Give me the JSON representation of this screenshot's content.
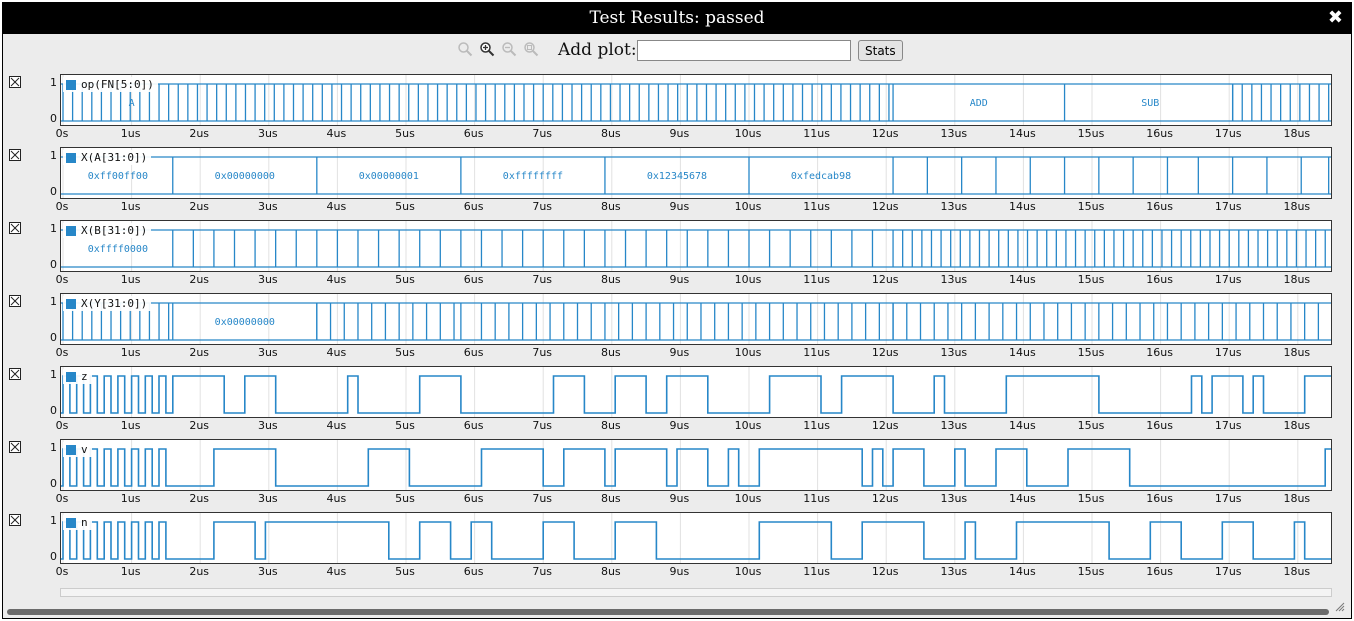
{
  "window": {
    "title": "Test Results: passed"
  },
  "toolbar": {
    "zoom_icons": [
      "zoom-out-disabled-icon",
      "zoom-in-icon",
      "zoom-reset-icon",
      "zoom-fit-icon"
    ],
    "add_plot_label": "Add plot:",
    "add_plot_value": "",
    "stats_label": "Stats"
  },
  "axis": {
    "x_ticks": [
      "0s",
      "1us",
      "2us",
      "3us",
      "4us",
      "5us",
      "6us",
      "7us",
      "8us",
      "9us",
      "10us",
      "11us",
      "12us",
      "13us",
      "14us",
      "15us",
      "16us",
      "17us",
      "18us"
    ],
    "y_ticks": [
      "1",
      "0"
    ],
    "x_range_us": [
      0,
      18.6
    ]
  },
  "colors": {
    "trace": "#2787c8",
    "text_on_trace": "#2787c8"
  },
  "plots": [
    {
      "name": "op(FN[5:0])",
      "kind": "bus",
      "fill": [
        [
          0,
          12.1,
          0.14
        ],
        [
          17.05,
          18.6,
          0.14
        ]
      ],
      "trans": [
        12.1,
        14.6,
        17.05
      ],
      "text": [
        {
          "t": 1.0,
          "v": "A"
        },
        {
          "t": 13.35,
          "v": "ADD"
        },
        {
          "t": 15.85,
          "v": "SUB"
        }
      ]
    },
    {
      "name": "X(A[31:0])",
      "kind": "bus",
      "fill": [],
      "trans": [
        1.6,
        3.7,
        5.8,
        7.9,
        10.0,
        12.1,
        12.6,
        13.1,
        13.6,
        14.1,
        14.6,
        15.1,
        15.6,
        16.1,
        16.55,
        17.05,
        17.55,
        18.05,
        18.45
      ],
      "text": [
        {
          "t": 0.8,
          "v": "0xff00ff00"
        },
        {
          "t": 2.65,
          "v": "0x00000000"
        },
        {
          "t": 4.75,
          "v": "0x00000001"
        },
        {
          "t": 6.85,
          "v": "0xffffffff"
        },
        {
          "t": 8.95,
          "v": "0x12345678"
        },
        {
          "t": 11.05,
          "v": "0xfedcab98"
        }
      ]
    },
    {
      "name": "X(B[31:0])",
      "kind": "bus",
      "fill": [
        [
          12.1,
          18.6,
          0.14
        ]
      ],
      "trans": [
        1.6,
        1.9,
        2.2,
        2.5,
        2.8,
        3.1,
        3.4,
        3.7,
        4.0,
        4.3,
        4.6,
        4.9,
        5.2,
        5.5,
        5.8,
        6.1,
        6.4,
        6.7,
        7.0,
        7.3,
        7.6,
        7.9,
        8.2,
        8.5,
        8.8,
        9.1,
        9.4,
        9.7,
        10.0,
        10.3,
        10.6,
        10.9,
        11.2,
        11.5,
        11.8
      ],
      "text": [
        {
          "t": 0.8,
          "v": "0xffff0000"
        }
      ]
    },
    {
      "name": "X(Y[31:0])",
      "kind": "bus",
      "fill": [
        [
          0,
          1.6,
          0.14
        ],
        [
          3.7,
          5.8,
          0.2
        ],
        [
          6.1,
          12.1,
          0.2
        ],
        [
          12.1,
          18.6,
          0.2
        ]
      ],
      "trans": [
        1.6,
        3.7,
        5.8
      ],
      "text": [
        {
          "t": 2.65,
          "v": "0x00000000"
        }
      ]
    },
    {
      "name": "z",
      "kind": "bit",
      "seed": 3,
      "dense": [
        0,
        1.6
      ]
    },
    {
      "name": "v",
      "kind": "bit",
      "seed": 11,
      "dense": [
        0,
        1.6
      ]
    },
    {
      "name": "n",
      "kind": "bit",
      "seed": 29,
      "dense": [
        0,
        1.6
      ]
    }
  ]
}
